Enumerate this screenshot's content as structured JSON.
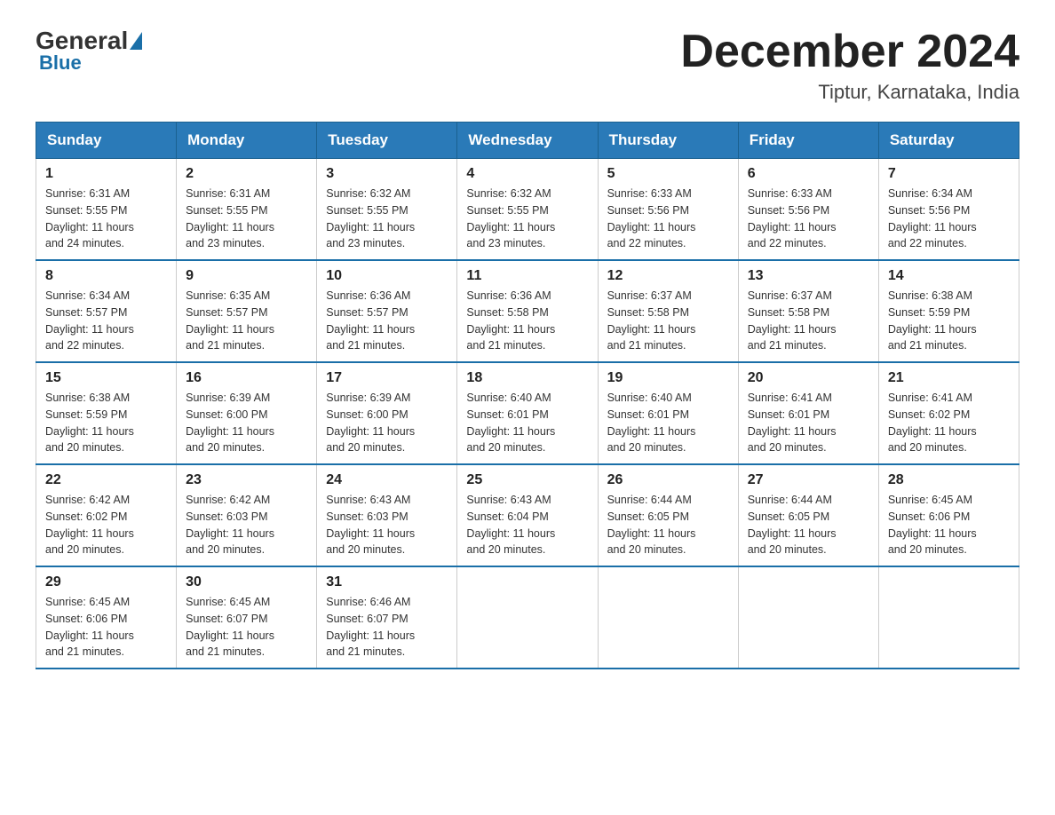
{
  "header": {
    "logo_general": "General",
    "logo_blue": "Blue",
    "month_title": "December 2024",
    "location": "Tiptur, Karnataka, India"
  },
  "days_of_week": [
    "Sunday",
    "Monday",
    "Tuesday",
    "Wednesday",
    "Thursday",
    "Friday",
    "Saturday"
  ],
  "weeks": [
    [
      {
        "day": "1",
        "sunrise": "6:31 AM",
        "sunset": "5:55 PM",
        "daylight": "11 hours and 24 minutes."
      },
      {
        "day": "2",
        "sunrise": "6:31 AM",
        "sunset": "5:55 PM",
        "daylight": "11 hours and 23 minutes."
      },
      {
        "day": "3",
        "sunrise": "6:32 AM",
        "sunset": "5:55 PM",
        "daylight": "11 hours and 23 minutes."
      },
      {
        "day": "4",
        "sunrise": "6:32 AM",
        "sunset": "5:55 PM",
        "daylight": "11 hours and 23 minutes."
      },
      {
        "day": "5",
        "sunrise": "6:33 AM",
        "sunset": "5:56 PM",
        "daylight": "11 hours and 22 minutes."
      },
      {
        "day": "6",
        "sunrise": "6:33 AM",
        "sunset": "5:56 PM",
        "daylight": "11 hours and 22 minutes."
      },
      {
        "day": "7",
        "sunrise": "6:34 AM",
        "sunset": "5:56 PM",
        "daylight": "11 hours and 22 minutes."
      }
    ],
    [
      {
        "day": "8",
        "sunrise": "6:34 AM",
        "sunset": "5:57 PM",
        "daylight": "11 hours and 22 minutes."
      },
      {
        "day": "9",
        "sunrise": "6:35 AM",
        "sunset": "5:57 PM",
        "daylight": "11 hours and 21 minutes."
      },
      {
        "day": "10",
        "sunrise": "6:36 AM",
        "sunset": "5:57 PM",
        "daylight": "11 hours and 21 minutes."
      },
      {
        "day": "11",
        "sunrise": "6:36 AM",
        "sunset": "5:58 PM",
        "daylight": "11 hours and 21 minutes."
      },
      {
        "day": "12",
        "sunrise": "6:37 AM",
        "sunset": "5:58 PM",
        "daylight": "11 hours and 21 minutes."
      },
      {
        "day": "13",
        "sunrise": "6:37 AM",
        "sunset": "5:58 PM",
        "daylight": "11 hours and 21 minutes."
      },
      {
        "day": "14",
        "sunrise": "6:38 AM",
        "sunset": "5:59 PM",
        "daylight": "11 hours and 21 minutes."
      }
    ],
    [
      {
        "day": "15",
        "sunrise": "6:38 AM",
        "sunset": "5:59 PM",
        "daylight": "11 hours and 20 minutes."
      },
      {
        "day": "16",
        "sunrise": "6:39 AM",
        "sunset": "6:00 PM",
        "daylight": "11 hours and 20 minutes."
      },
      {
        "day": "17",
        "sunrise": "6:39 AM",
        "sunset": "6:00 PM",
        "daylight": "11 hours and 20 minutes."
      },
      {
        "day": "18",
        "sunrise": "6:40 AM",
        "sunset": "6:01 PM",
        "daylight": "11 hours and 20 minutes."
      },
      {
        "day": "19",
        "sunrise": "6:40 AM",
        "sunset": "6:01 PM",
        "daylight": "11 hours and 20 minutes."
      },
      {
        "day": "20",
        "sunrise": "6:41 AM",
        "sunset": "6:01 PM",
        "daylight": "11 hours and 20 minutes."
      },
      {
        "day": "21",
        "sunrise": "6:41 AM",
        "sunset": "6:02 PM",
        "daylight": "11 hours and 20 minutes."
      }
    ],
    [
      {
        "day": "22",
        "sunrise": "6:42 AM",
        "sunset": "6:02 PM",
        "daylight": "11 hours and 20 minutes."
      },
      {
        "day": "23",
        "sunrise": "6:42 AM",
        "sunset": "6:03 PM",
        "daylight": "11 hours and 20 minutes."
      },
      {
        "day": "24",
        "sunrise": "6:43 AM",
        "sunset": "6:03 PM",
        "daylight": "11 hours and 20 minutes."
      },
      {
        "day": "25",
        "sunrise": "6:43 AM",
        "sunset": "6:04 PM",
        "daylight": "11 hours and 20 minutes."
      },
      {
        "day": "26",
        "sunrise": "6:44 AM",
        "sunset": "6:05 PM",
        "daylight": "11 hours and 20 minutes."
      },
      {
        "day": "27",
        "sunrise": "6:44 AM",
        "sunset": "6:05 PM",
        "daylight": "11 hours and 20 minutes."
      },
      {
        "day": "28",
        "sunrise": "6:45 AM",
        "sunset": "6:06 PM",
        "daylight": "11 hours and 20 minutes."
      }
    ],
    [
      {
        "day": "29",
        "sunrise": "6:45 AM",
        "sunset": "6:06 PM",
        "daylight": "11 hours and 21 minutes."
      },
      {
        "day": "30",
        "sunrise": "6:45 AM",
        "sunset": "6:07 PM",
        "daylight": "11 hours and 21 minutes."
      },
      {
        "day": "31",
        "sunrise": "6:46 AM",
        "sunset": "6:07 PM",
        "daylight": "11 hours and 21 minutes."
      },
      null,
      null,
      null,
      null
    ]
  ],
  "labels": {
    "sunrise": "Sunrise:",
    "sunset": "Sunset:",
    "daylight": "Daylight:"
  }
}
